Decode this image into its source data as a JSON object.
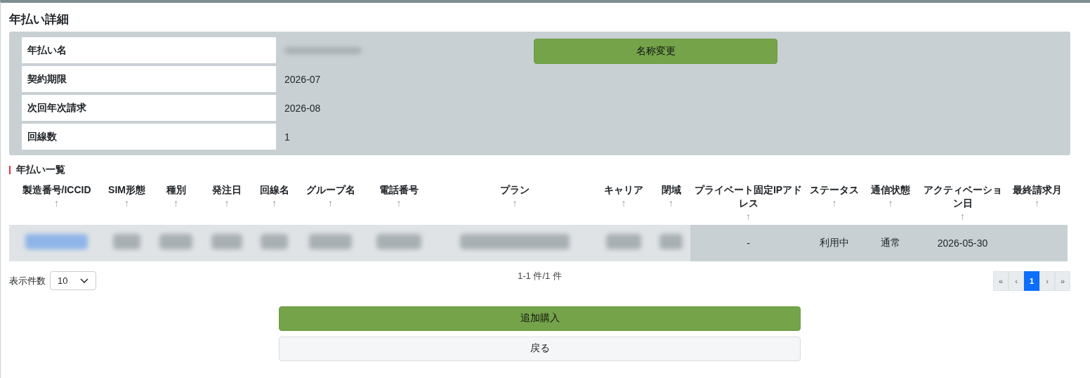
{
  "title": "年払い詳細",
  "details": [
    {
      "label": "年払い名",
      "kind": "redacted"
    },
    {
      "label": "契約期限",
      "kind": "text",
      "value": "2026-07"
    },
    {
      "label": "次回年次請求",
      "kind": "text",
      "value": "2026-08"
    },
    {
      "label": "回線数",
      "kind": "text",
      "value": "1"
    }
  ],
  "rename_button": "名称変更",
  "list_title": "年払い一覧",
  "table": {
    "columns": [
      {
        "label": "製造番号/ICCID",
        "sort_mark": "↑"
      },
      {
        "label": "SIM形態",
        "sort_mark": "↑"
      },
      {
        "label": "種別",
        "sort_mark": "↑"
      },
      {
        "label": "発注日",
        "sort_mark": "↑"
      },
      {
        "label": "回線名",
        "sort_mark": "↑"
      },
      {
        "label": "グループ名",
        "sort_mark": "↑"
      },
      {
        "label": "電話番号",
        "sort_mark": "↑"
      },
      {
        "label": "プラン",
        "sort_mark": "↑"
      },
      {
        "label": "キャリア",
        "sort_mark": "↑"
      },
      {
        "label": "閉域",
        "sort_mark": "↑"
      },
      {
        "label": "プライベート固定IPアドレス",
        "sort_mark": "↑"
      },
      {
        "label": "ステータス",
        "sort_mark": "↑"
      },
      {
        "label": "通信状態",
        "sort_mark": "↑"
      },
      {
        "label": "アクティベーション日",
        "sort_mark": "↑"
      },
      {
        "label": "最終請求月",
        "sort_mark": "↑"
      }
    ],
    "rows": [
      {
        "cells": [
          {
            "kind": "redacted-link"
          },
          {
            "kind": "redacted"
          },
          {
            "kind": "redacted"
          },
          {
            "kind": "redacted"
          },
          {
            "kind": "redacted"
          },
          {
            "kind": "redacted"
          },
          {
            "kind": "redacted"
          },
          {
            "kind": "redacted"
          },
          {
            "kind": "redacted"
          },
          {
            "kind": "redacted"
          },
          {
            "kind": "text",
            "text": "-"
          },
          {
            "kind": "text",
            "text": "利用中"
          },
          {
            "kind": "text",
            "text": "通常"
          },
          {
            "kind": "text",
            "text": "2026-05-30"
          },
          {
            "kind": "empty"
          }
        ]
      }
    ]
  },
  "page_size": {
    "label": "表示件数",
    "value": "10"
  },
  "count": "1-1 件/1 件",
  "pagination": [
    {
      "label": "«",
      "selected": false
    },
    {
      "label": "‹",
      "selected": false
    },
    {
      "label": "1",
      "selected": true
    },
    {
      "label": "›",
      "selected": false
    },
    {
      "label": "»",
      "selected": false
    }
  ],
  "buttons": [
    {
      "kind": "primary",
      "label": "追加購入"
    },
    {
      "kind": "secondary",
      "label": "戻る"
    }
  ]
}
